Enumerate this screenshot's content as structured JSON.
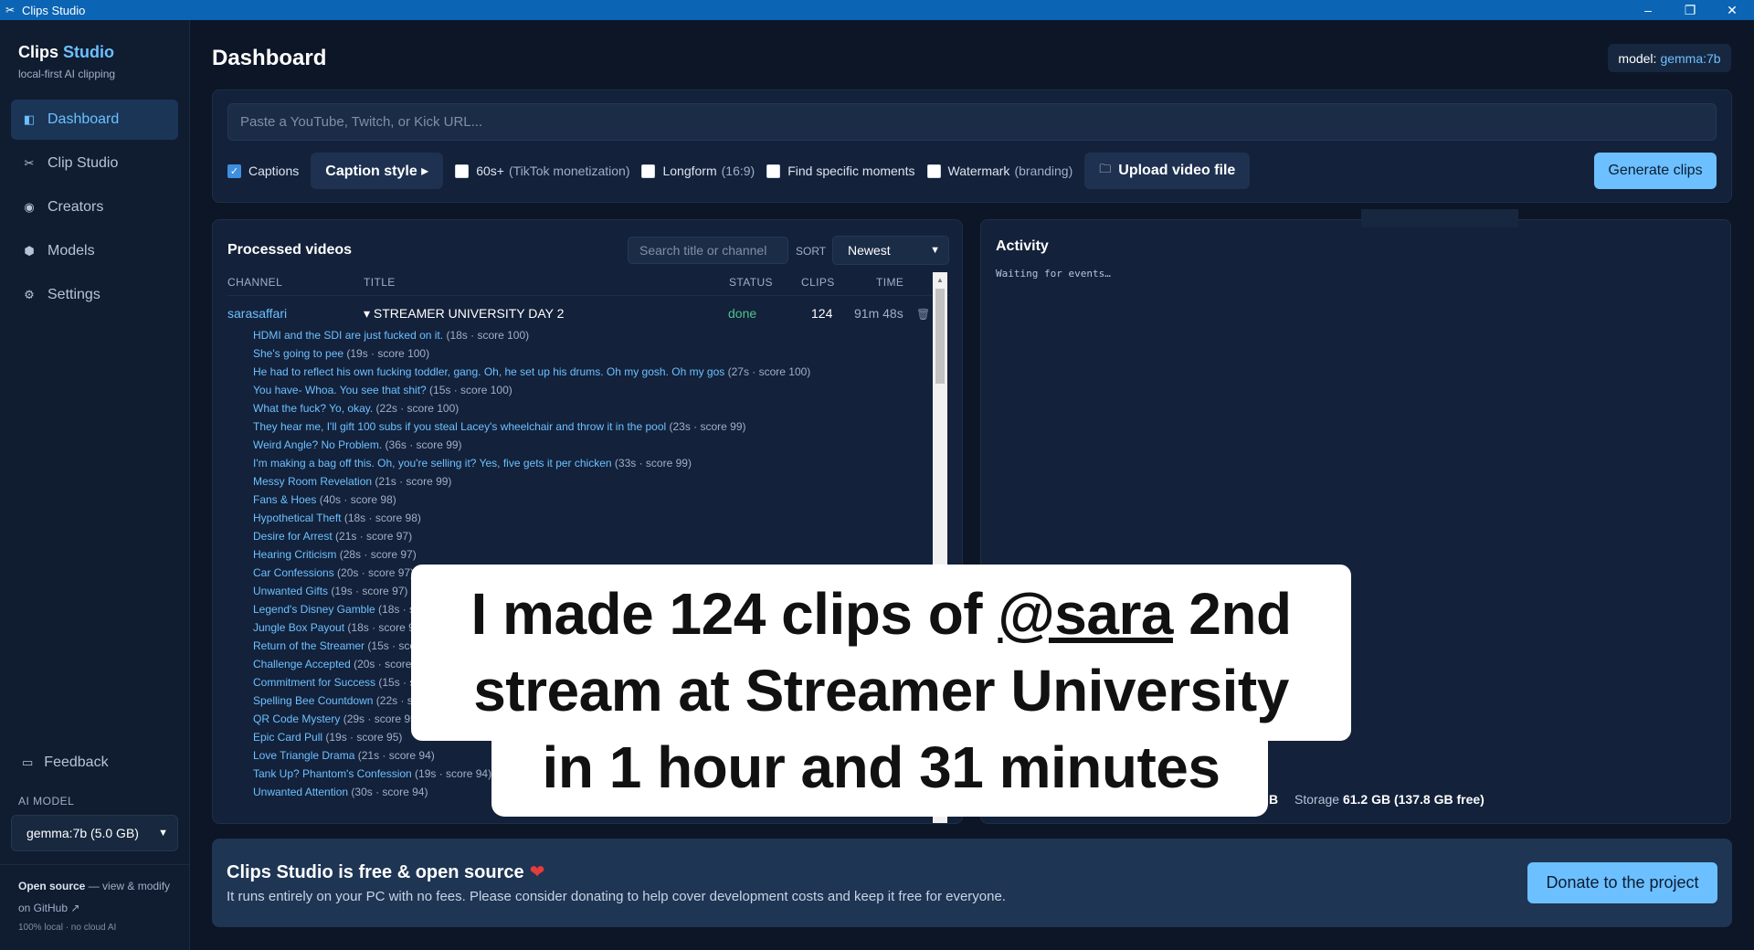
{
  "window": {
    "title": "Clips Studio",
    "minimize": "–",
    "restore": "❐",
    "close": "✕"
  },
  "sidebar": {
    "brand_first": "Clips",
    "brand_accent": "Studio",
    "brand_sub": "local-first AI clipping",
    "items": [
      {
        "label": "Dashboard",
        "icon": "◧"
      },
      {
        "label": "Clip Studio",
        "icon": "✂"
      },
      {
        "label": "Creators",
        "icon": "◉"
      },
      {
        "label": "Models",
        "icon": "⬢"
      },
      {
        "label": "Settings",
        "icon": "⚙"
      }
    ],
    "feedback": "Feedback",
    "feedback_icon": "▭",
    "ai_model_label": "AI MODEL",
    "ai_model_value": "gemma:7b (5.0 GB)",
    "oss_bold": "Open source",
    "oss_rest": " — view & modify on GitHub ↗",
    "oss_sub": "100% local · no cloud AI"
  },
  "header": {
    "title": "Dashboard",
    "model_label": "model:",
    "model_value": "gemma:7b"
  },
  "url_card": {
    "placeholder": "Paste a YouTube, Twitch, or Kick URL...",
    "captions": "Captions",
    "caption_style": "Caption style ▸",
    "opt_60": "60s+",
    "opt_60_note": "(TikTok monetization)",
    "longform": "Longform",
    "longform_note": "(16:9)",
    "find": "Find specific moments",
    "watermark": "Watermark",
    "watermark_note": "(branding)",
    "upload": "Upload video file",
    "generate": "Generate clips"
  },
  "processed": {
    "title": "Processed videos",
    "search_placeholder": "Search title or channel",
    "sort_label": "SORT",
    "sort_value": "Newest",
    "columns": [
      "CHANNEL",
      "TITLE",
      "STATUS",
      "CLIPS",
      "TIME"
    ],
    "row": {
      "channel": "sarasaffari",
      "title": "▾ STREAMER UNIVERSITY DAY 2",
      "status": "done",
      "clips": "124",
      "time": "91m 48s",
      "delete_icon": "🗑"
    },
    "clips": [
      {
        "title": "HDMI and the SDI are just fucked on it.",
        "meta": " (18s · score 100)"
      },
      {
        "title": "She's going to pee",
        "meta": " (19s · score 100)"
      },
      {
        "title": "He had to reflect his own fucking toddler, gang. Oh, he set up his drums. Oh my gosh. Oh my gos",
        "meta": " (27s · score 100)"
      },
      {
        "title": "You have- Whoa. You see that shit?",
        "meta": " (15s · score 100)"
      },
      {
        "title": "What the fuck? Yo, okay.",
        "meta": " (22s · score 100)"
      },
      {
        "title": "They hear me, I'll gift 100 subs if you steal Lacey's wheelchair and throw it in the pool",
        "meta": " (23s · score 99)"
      },
      {
        "title": "Weird Angle? No Problem.",
        "meta": " (36s · score 99)"
      },
      {
        "title": "I'm making a bag off this. Oh, you're selling it? Yes, five gets it per chicken",
        "meta": " (33s · score 99)"
      },
      {
        "title": "Messy Room Revelation",
        "meta": " (21s · score 99)"
      },
      {
        "title": "Fans & Hoes",
        "meta": " (40s · score 98)"
      },
      {
        "title": "Hypothetical Theft",
        "meta": " (18s · score 98)"
      },
      {
        "title": "Desire for Arrest",
        "meta": " (21s · score 97)"
      },
      {
        "title": "Hearing Criticism",
        "meta": " (28s · score 97)"
      },
      {
        "title": "Car Confessions",
        "meta": " (20s · score 97)"
      },
      {
        "title": "Unwanted Gifts",
        "meta": " (19s · score 97)"
      },
      {
        "title": "Legend's Disney Gamble",
        "meta": " (18s · sc"
      },
      {
        "title": "Jungle Box Payout",
        "meta": " (18s · score 96"
      },
      {
        "title": "Return of the Streamer",
        "meta": " (15s · sco"
      },
      {
        "title": "Challenge Accepted",
        "meta": " (20s · score 9"
      },
      {
        "title": "Commitment for Success",
        "meta": " (15s · sc"
      },
      {
        "title": "Spelling Bee Countdown",
        "meta": " (22s · sc"
      },
      {
        "title": "QR Code Mystery",
        "meta": " (29s · score 95"
      },
      {
        "title": "Epic Card Pull",
        "meta": " (19s · score 95)"
      },
      {
        "title": "Love Triangle Drama",
        "meta": " (21s · score 94)"
      },
      {
        "title": "Tank Up? Phantom's Confession",
        "meta": " (19s · score 94)"
      },
      {
        "title": "Unwanted Attention",
        "meta": " (30s · score 94)"
      }
    ]
  },
  "activity": {
    "title": "Activity",
    "log": "Waiting for events…",
    "stats_prefix": "B",
    "storage_label": "Storage",
    "storage_value": "61.2 GB (137.8 GB free)"
  },
  "overlay": {
    "line1_pre": "I made 124 clips of ",
    "line1_handle": "@sara",
    "line1_post": " 2nd",
    "line2": "stream at Streamer University",
    "line3": "in 1 hour and 31 minutes"
  },
  "donate": {
    "title": "Clips Studio is free & open source",
    "heart": "❤",
    "text": "It runs entirely on your PC with no fees. Please consider donating to help cover development costs and keep it free for everyone.",
    "button": "Donate to the project"
  },
  "colors": {
    "accent": "#6cc0ff",
    "status_done": "#4cc38a",
    "titlebar": "#0b64b4",
    "background": "#0d1626"
  }
}
